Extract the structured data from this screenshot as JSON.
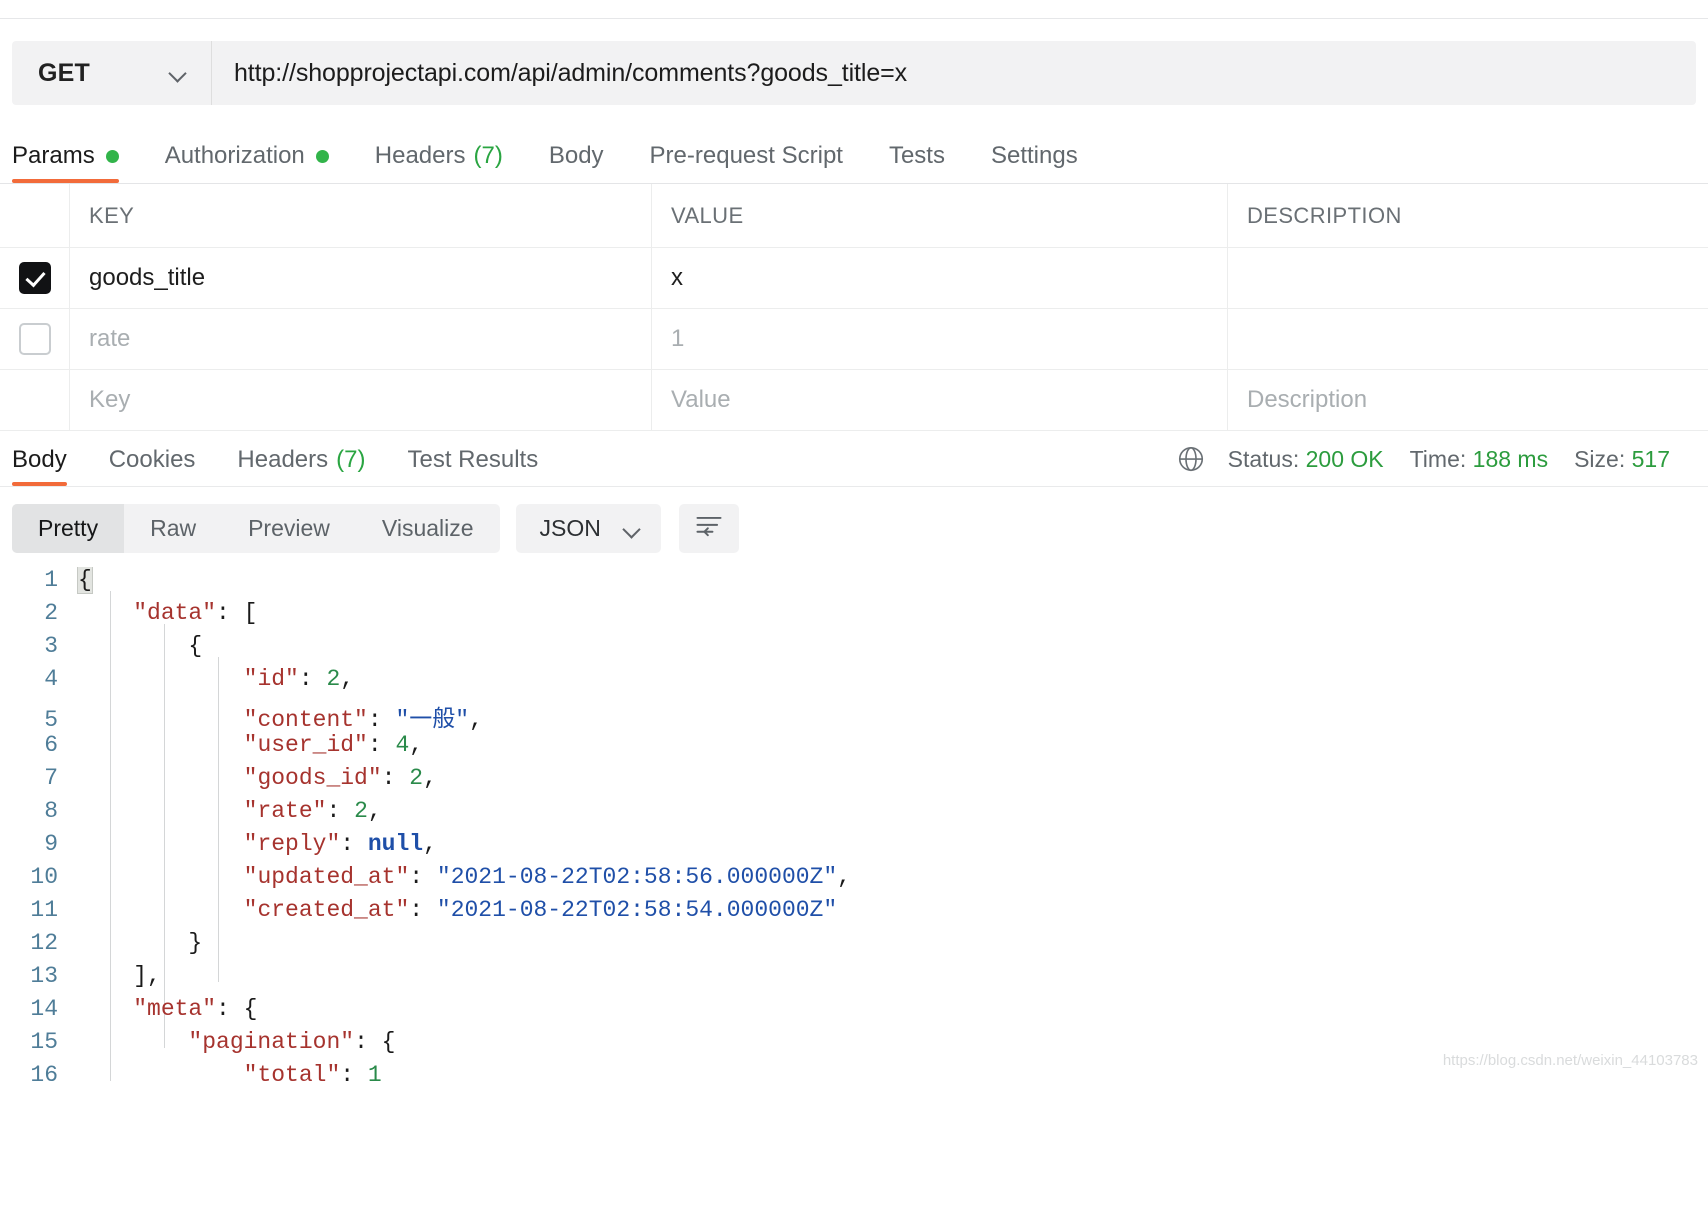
{
  "request": {
    "method": "GET",
    "url": "http://shopprojectapi.com/api/admin/comments?goods_title=x",
    "tabs": [
      {
        "label": "Params",
        "dot": true,
        "active": true
      },
      {
        "label": "Authorization",
        "dot": true,
        "active": false
      },
      {
        "label": "Headers",
        "count": "(7)",
        "active": false
      },
      {
        "label": "Body",
        "active": false
      },
      {
        "label": "Pre-request Script",
        "active": false
      },
      {
        "label": "Tests",
        "active": false
      },
      {
        "label": "Settings",
        "active": false
      }
    ]
  },
  "params": {
    "columns": {
      "key": "KEY",
      "value": "VALUE",
      "description": "DESCRIPTION"
    },
    "rows": [
      {
        "checked": true,
        "key": "goods_title",
        "value": "x",
        "description": "",
        "placeholder": false
      },
      {
        "checked": false,
        "key": "rate",
        "value": "1",
        "description": "",
        "placeholder": false
      },
      {
        "checked": false,
        "key": "Key",
        "value": "Value",
        "description": "Description",
        "placeholder": true
      }
    ]
  },
  "response": {
    "tabs": [
      {
        "label": "Body",
        "active": true
      },
      {
        "label": "Cookies",
        "active": false
      },
      {
        "label": "Headers",
        "count": "(7)",
        "active": false
      },
      {
        "label": "Test Results",
        "active": false
      }
    ],
    "status_label": "Status:",
    "status_value": "200 OK",
    "time_label": "Time:",
    "time_value": "188 ms",
    "size_label": "Size:",
    "size_value": "517",
    "view_modes": [
      {
        "label": "Pretty",
        "active": true
      },
      {
        "label": "Raw",
        "active": false
      },
      {
        "label": "Preview",
        "active": false
      },
      {
        "label": "Visualize",
        "active": false
      }
    ],
    "format": "JSON"
  },
  "code": {
    "lines": [
      {
        "no": "1",
        "segs": [
          {
            "t": "{",
            "c": "p",
            "hl": true
          }
        ]
      },
      {
        "no": "2",
        "segs": [
          {
            "t": "    ",
            "c": "p"
          },
          {
            "t": "\"data\"",
            "c": "k"
          },
          {
            "t": ": [",
            "c": "p"
          }
        ]
      },
      {
        "no": "3",
        "segs": [
          {
            "t": "        {",
            "c": "p"
          }
        ]
      },
      {
        "no": "4",
        "segs": [
          {
            "t": "            ",
            "c": "p"
          },
          {
            "t": "\"id\"",
            "c": "k"
          },
          {
            "t": ": ",
            "c": "p"
          },
          {
            "t": "2",
            "c": "n"
          },
          {
            "t": ",",
            "c": "p"
          }
        ]
      },
      {
        "no": "5",
        "segs": [
          {
            "t": "            ",
            "c": "p"
          },
          {
            "t": "\"content\"",
            "c": "k"
          },
          {
            "t": ": ",
            "c": "p"
          },
          {
            "t": "\"一般\"",
            "c": "s"
          },
          {
            "t": ",",
            "c": "p"
          }
        ]
      },
      {
        "no": "6",
        "segs": [
          {
            "t": "            ",
            "c": "p"
          },
          {
            "t": "\"user_id\"",
            "c": "k"
          },
          {
            "t": ": ",
            "c": "p"
          },
          {
            "t": "4",
            "c": "n"
          },
          {
            "t": ",",
            "c": "p"
          }
        ]
      },
      {
        "no": "7",
        "segs": [
          {
            "t": "            ",
            "c": "p"
          },
          {
            "t": "\"goods_id\"",
            "c": "k"
          },
          {
            "t": ": ",
            "c": "p"
          },
          {
            "t": "2",
            "c": "n"
          },
          {
            "t": ",",
            "c": "p"
          }
        ]
      },
      {
        "no": "8",
        "segs": [
          {
            "t": "            ",
            "c": "p"
          },
          {
            "t": "\"rate\"",
            "c": "k"
          },
          {
            "t": ": ",
            "c": "p"
          },
          {
            "t": "2",
            "c": "n"
          },
          {
            "t": ",",
            "c": "p"
          }
        ]
      },
      {
        "no": "9",
        "segs": [
          {
            "t": "            ",
            "c": "p"
          },
          {
            "t": "\"reply\"",
            "c": "k"
          },
          {
            "t": ": ",
            "c": "p"
          },
          {
            "t": "null",
            "c": "nl"
          },
          {
            "t": ",",
            "c": "p"
          }
        ]
      },
      {
        "no": "10",
        "segs": [
          {
            "t": "            ",
            "c": "p"
          },
          {
            "t": "\"updated_at\"",
            "c": "k"
          },
          {
            "t": ": ",
            "c": "p"
          },
          {
            "t": "\"2021-08-22T02:58:56.000000Z\"",
            "c": "s"
          },
          {
            "t": ",",
            "c": "p"
          }
        ]
      },
      {
        "no": "11",
        "segs": [
          {
            "t": "            ",
            "c": "p"
          },
          {
            "t": "\"created_at\"",
            "c": "k"
          },
          {
            "t": ": ",
            "c": "p"
          },
          {
            "t": "\"2021-08-22T02:58:54.000000Z\"",
            "c": "s"
          }
        ]
      },
      {
        "no": "12",
        "segs": [
          {
            "t": "        }",
            "c": "p"
          }
        ]
      },
      {
        "no": "13",
        "segs": [
          {
            "t": "    ],",
            "c": "p"
          }
        ]
      },
      {
        "no": "14",
        "segs": [
          {
            "t": "    ",
            "c": "p"
          },
          {
            "t": "\"meta\"",
            "c": "k"
          },
          {
            "t": ": {",
            "c": "p"
          }
        ]
      },
      {
        "no": "15",
        "segs": [
          {
            "t": "        ",
            "c": "p"
          },
          {
            "t": "\"pagination\"",
            "c": "k"
          },
          {
            "t": ": {",
            "c": "p"
          }
        ]
      },
      {
        "no": "16",
        "segs": [
          {
            "t": "            ",
            "c": "p"
          },
          {
            "t": "\"total\"",
            "c": "k"
          },
          {
            "t": ": ",
            "c": "p"
          },
          {
            "t": "1",
            "c": "n"
          }
        ]
      }
    ]
  },
  "watermark": "https://blog.csdn.net/weixin_44103783"
}
